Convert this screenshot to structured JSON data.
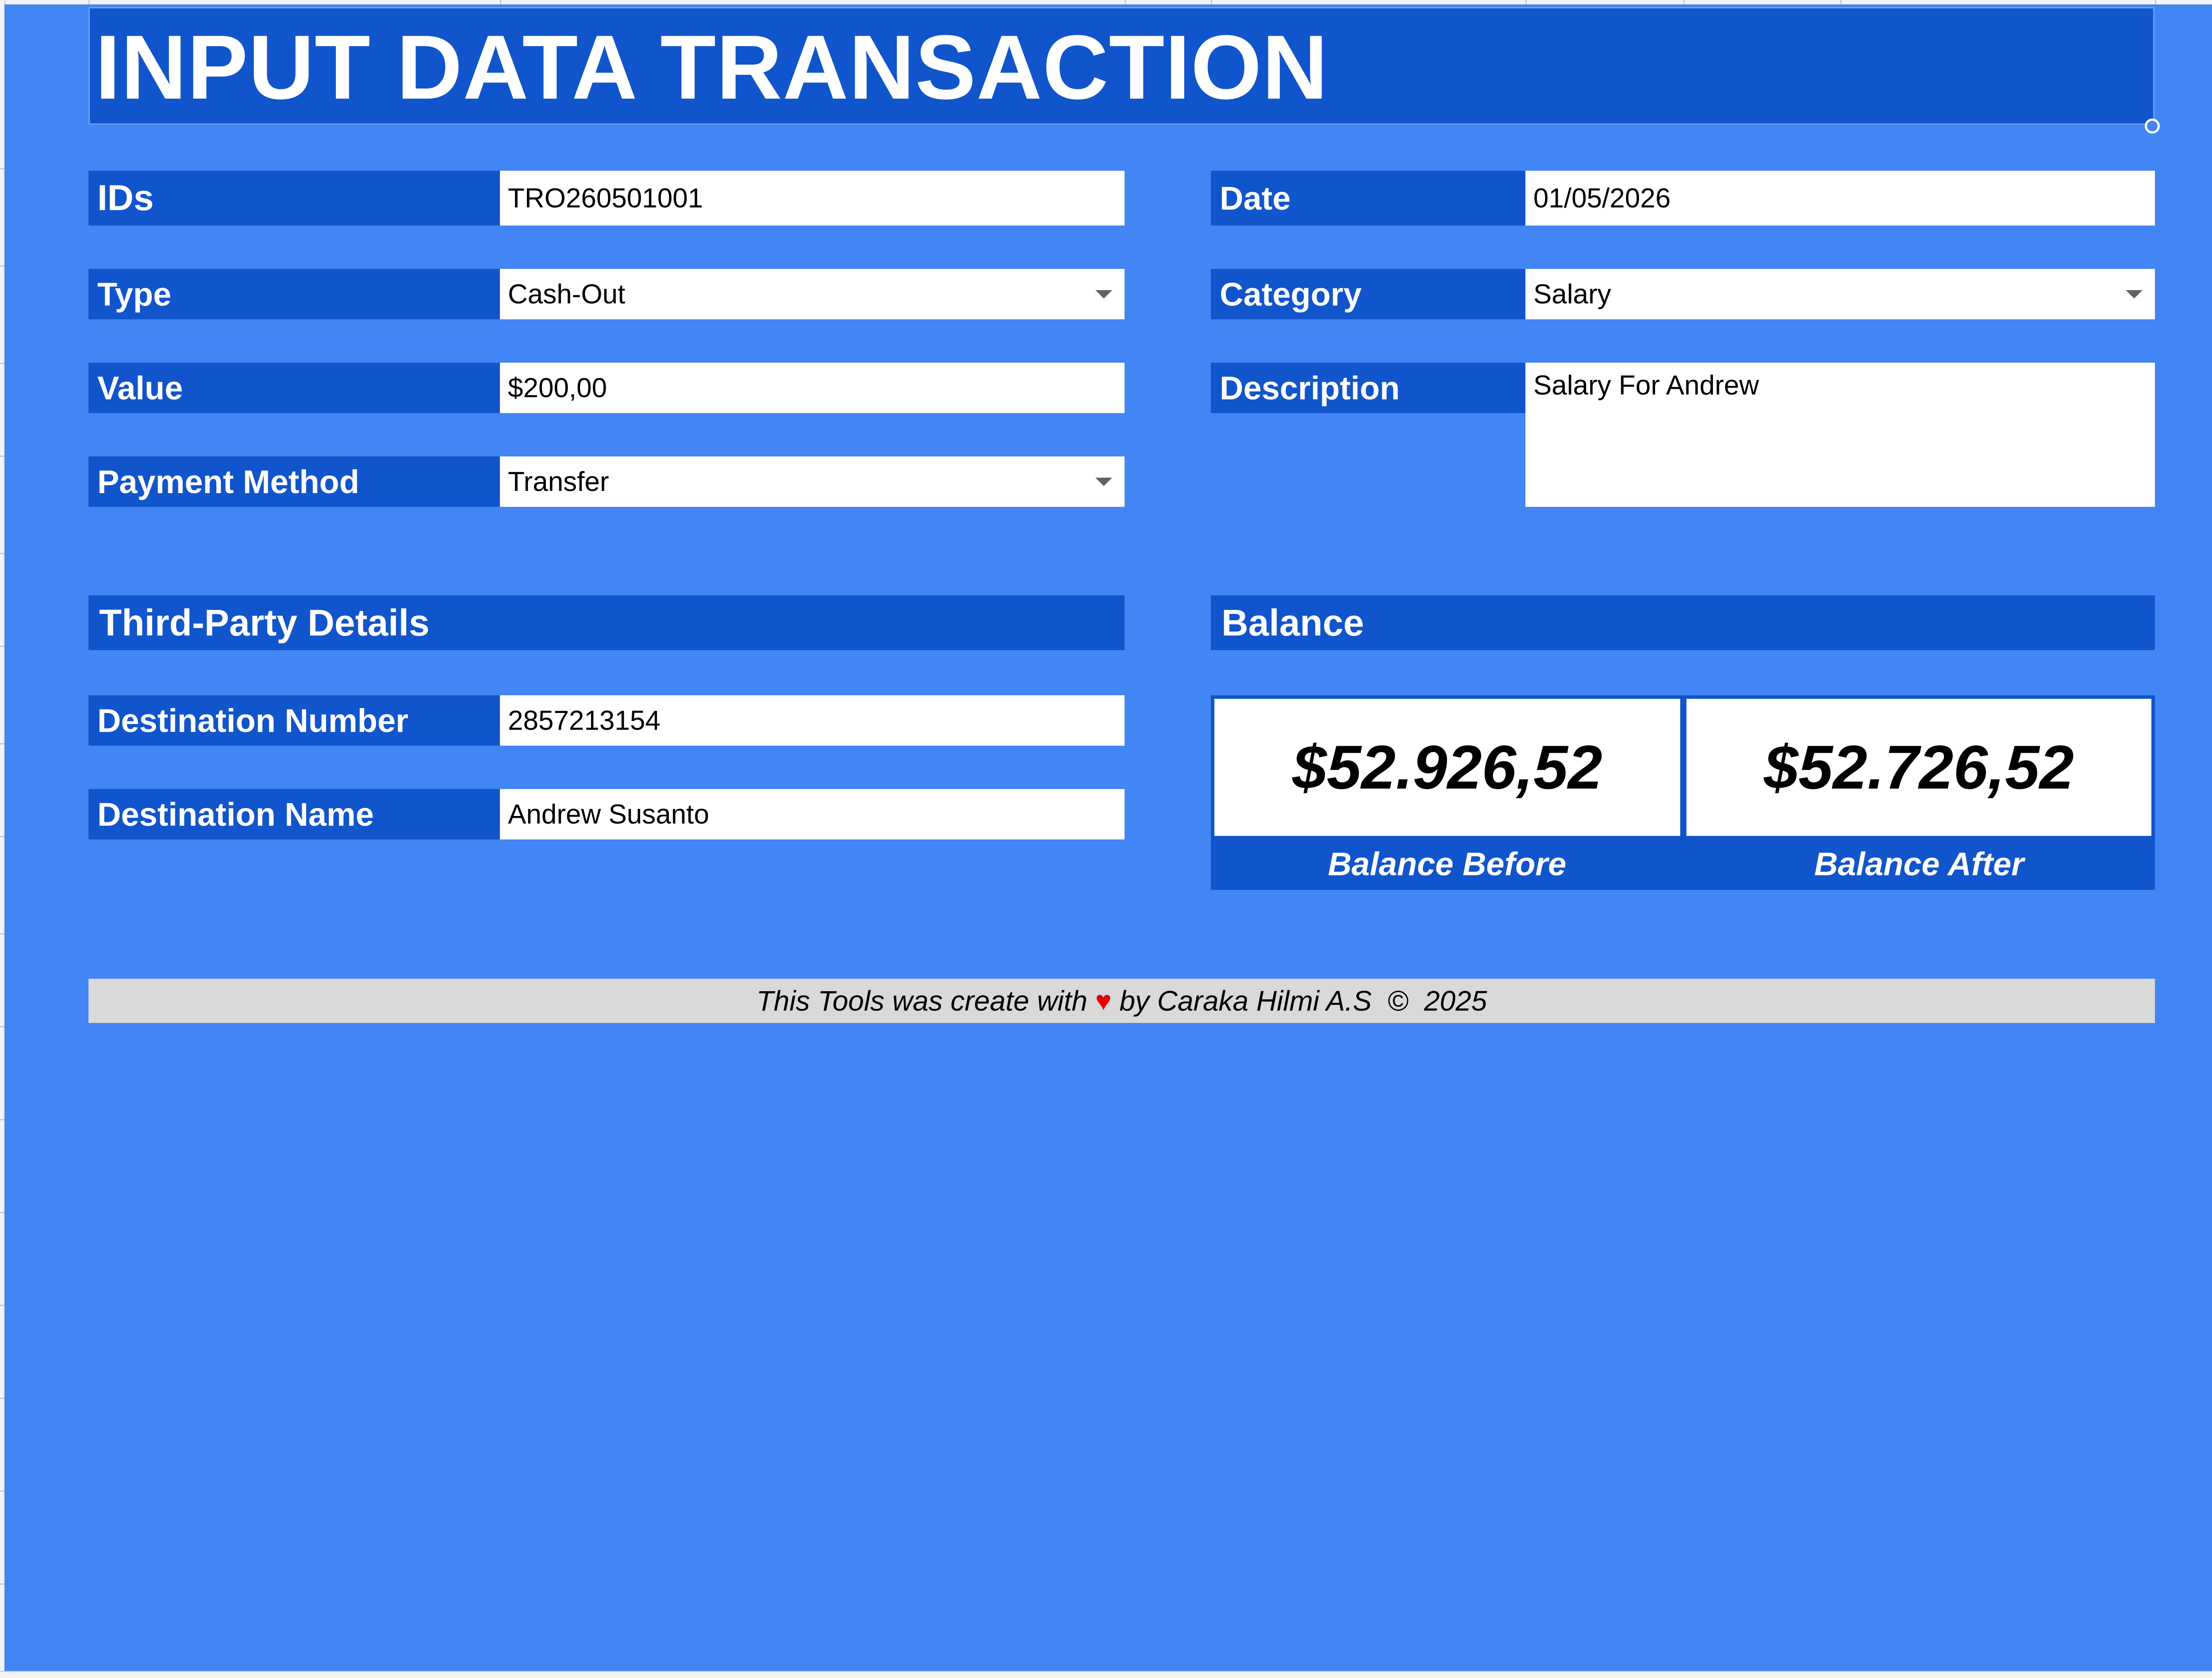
{
  "title": "INPUT DATA TRANSACTION",
  "fields": {
    "ids": {
      "label": "IDs",
      "value": "TRO260501001"
    },
    "type": {
      "label": "Type",
      "value": "Cash-Out"
    },
    "value": {
      "label": "Value",
      "value": "$200,00"
    },
    "payment_method": {
      "label": "Payment Method",
      "value": "Transfer"
    },
    "date": {
      "label": "Date",
      "value": "01/05/2026"
    },
    "category": {
      "label": "Category",
      "value": "Salary"
    },
    "description": {
      "label": "Description",
      "value": "Salary For Andrew"
    }
  },
  "third_party": {
    "section_title": "Third-Party Details",
    "destination_number": {
      "label": "Destination Number",
      "value": "2857213154"
    },
    "destination_name": {
      "label": "Destination Name",
      "value": "Andrew Susanto"
    }
  },
  "balance": {
    "section_title": "Balance",
    "before": {
      "amount": "$52.926,52",
      "caption": "Balance Before"
    },
    "after": {
      "amount": "$52.726,52",
      "caption": "Balance After"
    }
  },
  "footer": {
    "prefix": "This Tools was create with ",
    "heart": "♥",
    "suffix": " by Caraka Hilmi A.S  ©  2025"
  },
  "colors": {
    "background": "#4285f4",
    "header": "#1155cc",
    "field": "#ffffff",
    "footer": "#d9d9d9",
    "heart": "#e00000"
  }
}
